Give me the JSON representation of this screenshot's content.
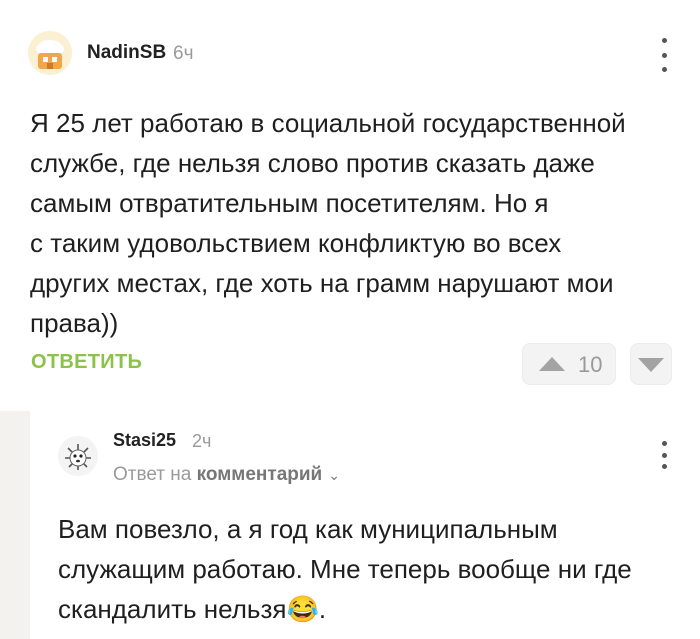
{
  "comment": {
    "username": "NadinSB",
    "time": "6ч",
    "text_lines": [
      "Я 25 лет работаю в социальной государственной",
      "службе, где нельзя слово против сказать даже",
      "самым отвратительным посетителям. Но я",
      "с таким удовольствием конфликтую во всех",
      "других местах, где хоть на грамм нарушают мои",
      "права))"
    ],
    "reply_label": "ОТВЕТИТЬ",
    "rating": "10"
  },
  "reply": {
    "username": "Stasi25",
    "time": "2ч",
    "reply_prefix": "Ответ на",
    "reply_target": "комментарий",
    "text_lines": [
      "Вам повезло, а я год как муниципальным",
      "служащим работаю. Мне теперь вообще ни где",
      "скандалить нельзя😂."
    ]
  },
  "icons": {
    "menu": "more-vertical-icon",
    "upvote": "arrow-up-icon",
    "downvote": "arrow-down-icon",
    "chevron": "chevron-down-icon"
  },
  "colors": {
    "accent": "#8bc34a",
    "muted": "#9a9a9a",
    "background": "#ffffff"
  }
}
